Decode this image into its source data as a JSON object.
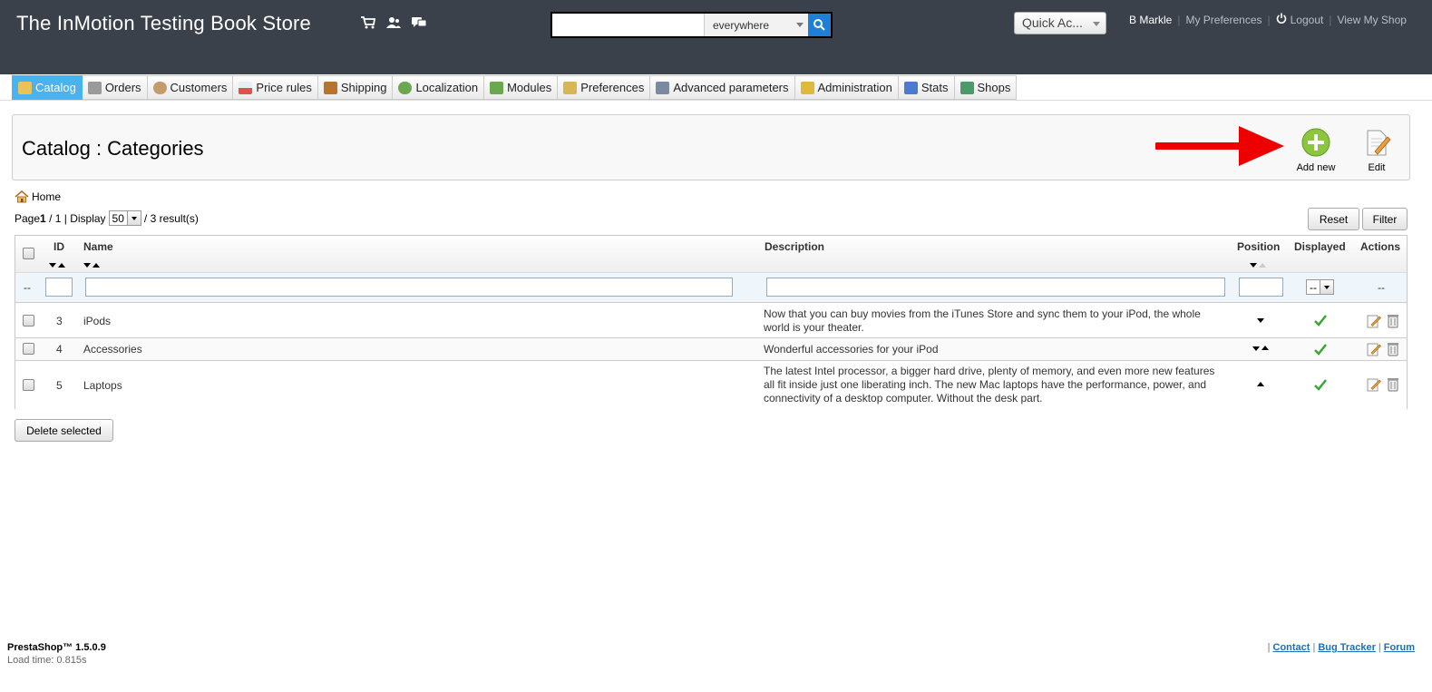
{
  "header": {
    "shop_title": "The InMotion Testing Book Store",
    "search_value": "",
    "search_scope": "everywhere",
    "quick_access": "Quick Ac...",
    "user_name": "B Markle",
    "my_preferences": "My Preferences",
    "logout": "Logout",
    "view_shop": "View My Shop"
  },
  "tabs": [
    {
      "label": "Catalog",
      "icon": "folder-icon",
      "color": "#e8c35a"
    },
    {
      "label": "Orders",
      "icon": "cart-icon",
      "color": "#8a8a8a"
    },
    {
      "label": "Customers",
      "icon": "user-icon",
      "color": "#c79a6e"
    },
    {
      "label": "Price rules",
      "icon": "price-icon",
      "color": "#d9534f"
    },
    {
      "label": "Shipping",
      "icon": "truck-icon",
      "color": "#b8742c"
    },
    {
      "label": "Localization",
      "icon": "globe-icon",
      "color": "#6aa84f"
    },
    {
      "label": "Modules",
      "icon": "puzzle-icon",
      "color": "#6aa84f"
    },
    {
      "label": "Preferences",
      "icon": "prefs-icon",
      "color": "#d6b656"
    },
    {
      "label": "Advanced parameters",
      "icon": "wrench-icon",
      "color": "#7a8aa0"
    },
    {
      "label": "Administration",
      "icon": "key-icon",
      "color": "#e0b83a"
    },
    {
      "label": "Stats",
      "icon": "stats-icon",
      "color": "#4a7bd0"
    },
    {
      "label": "Shops",
      "icon": "shop-icon",
      "color": "#4a9a6a"
    }
  ],
  "page": {
    "title": "Catalog : Categories",
    "add_new": "Add new",
    "edit": "Edit",
    "breadcrumb": "Home",
    "page_label": "Page",
    "page_current": "1",
    "page_total": "/ 1 | Display",
    "display_count": "50",
    "results": "/ 3 result(s)",
    "reset": "Reset",
    "filter": "Filter"
  },
  "table": {
    "columns": {
      "id": "ID",
      "name": "Name",
      "description": "Description",
      "position": "Position",
      "displayed": "Displayed",
      "actions": "Actions"
    },
    "filter_dash": "--",
    "filter_select": "--",
    "rows": [
      {
        "id": "3",
        "name": "iPods",
        "description": "Now that you can buy movies from the iTunes Store and sync them to your iPod, the whole world is your theater.",
        "displayed": true
      },
      {
        "id": "4",
        "name": "Accessories",
        "description": "Wonderful accessories for your iPod",
        "displayed": true
      },
      {
        "id": "5",
        "name": "Laptops",
        "description": "The latest Intel processor, a bigger hard drive, plenty of memory, and even more new features all fit inside just one liberating inch. The new Mac laptops have the performance, power, and connectivity of a desktop computer. Without the desk part.",
        "displayed": true
      }
    ]
  },
  "delete_selected": "Delete selected",
  "footer": {
    "version": "PrestaShop™ 1.5.0.9",
    "load_time": "Load time: 0.815s",
    "contact": "Contact",
    "bug_tracker": "Bug Tracker",
    "forum": "Forum"
  }
}
